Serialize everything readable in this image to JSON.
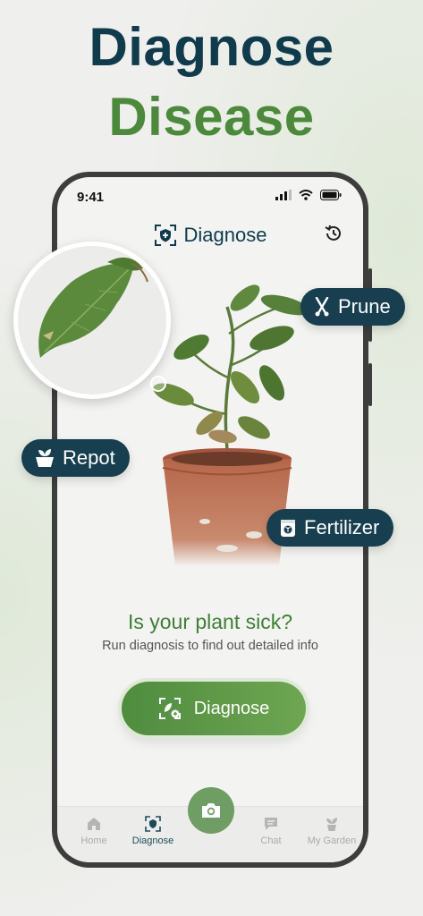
{
  "hero": {
    "line1": "Diagnose",
    "line2": "Disease"
  },
  "status": {
    "time": "9:41"
  },
  "header": {
    "title": "Diagnose"
  },
  "prompt": {
    "title": "Is your plant sick?",
    "subtitle": "Run diagnosis to find out detailed info"
  },
  "cta": {
    "label": "Diagnose"
  },
  "tabs": [
    {
      "label": "Home",
      "icon": "home-icon"
    },
    {
      "label": "Diagnose",
      "icon": "diagnose-icon"
    },
    {
      "label": "Chat",
      "icon": "chat-icon"
    },
    {
      "label": "My Garden",
      "icon": "plant-icon"
    }
  ],
  "callouts": {
    "prune": "Prune",
    "repot": "Repot",
    "fertilizer": "Fertilizer"
  },
  "colors": {
    "navy": "#0f3b4c",
    "green": "#4b8a3a",
    "pill": "#173f4f",
    "camera": "#6e9e63"
  }
}
